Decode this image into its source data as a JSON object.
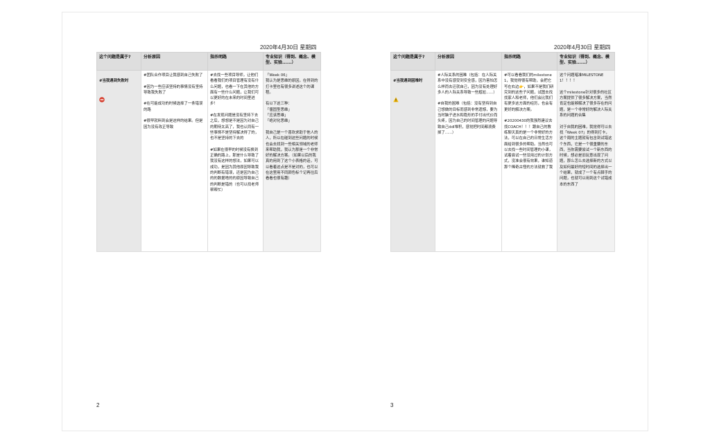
{
  "pages": [
    {
      "date": "2020年4月30日 星期四",
      "page_number": "2",
      "headers": [
        "这个问题是属于?",
        "分析原因",
        "指杀明路",
        "专业知识（得到、概念、模型、实验......）"
      ],
      "question": "#当我遇到失败时",
      "icon": "red-no-entry-icon",
      "cells": [
        "#团队合作项目让我感到自己失败了\n\n#因为一些应该坚持的事情没有坚持导致我失败了\n\n#在可能成功的时候选择了一条错误的路\n\n#很早就料到会是这样的结果。但是因为没有改正导致",
        "#去找一些项目导师，让他们看看我们的项目管理有没有什么问题，也看一下在其他的方面有一些什么问题，让我们可以更好的在未来的时间里进步！\n\n#在发现问题是没有坚持下去之后，想想是不是因为对自己的期待太高了，我也认同有一些事情不是坚持解决得了的，也不是坚持的下去的\n\n#如果在很早的时候没有换到正确的路上，那是什么导致了我没有这样的想法，如果可以成功，是因为其他原因导致我的判断有错误，还是因为自己的的数据啥的的原因导致自己的判断是错的（也可以找老师帮帮忙）",
        "「Week 06」\n我认为是思维的原因，在得到的打卡里也有很多讲述这个的课程。\n\n有以下这三种：\n「僵固型思维」\n「应该思维」\n「绝对化思维」\n\n我自己是一个喜欢求助于他人的人，所以在碰到这些问题的时候也会去找到一些相关领域的老师来帮助我，我认为那是一个非常好的解决方案。（如果以后的我真的用到了这个小表格的话，可以看着这点是不是对的，也可以在这里用不同颜色标个记再往后看看也很有趣）"
      ]
    },
    {
      "date": "2020年4月30日 星期四",
      "page_number": "3",
      "headers": [
        "这个问题是属于?",
        "分析原因",
        "指杀明路",
        "专业知识（得到、概念、模型、实验......）"
      ],
      "question": "#当我遇到困难时",
      "icon": "warning-icon",
      "cells": [
        "#人际关系的困难（包括：在人际关系中没有感受到安全感，因为害怕怎么样而去迁就自己，因为没有处理好多人的人际关系导致一些尴尬......）\n\n#自我的困难（包括：没有坚持到自己想做的目标而感到非常遗憾，要为当时脑子进水和隐形的手付出代价而头疼，因为自己的时间管理的问题导致自己ddl堆积，感觉把时间都浪费掉了......）",
        "#可以看看我们的milestone1，我觉得很有帮助，会把它写在右边👉，如果不是我们研究到的这些子问题，试图去找找家人和老师，他们会比我们有更多这方面的经历，也会有更好的解决方案。\n\n#20200430的我强烈建议去找COACH！！！跟自己的教练聊天真的是一个非常好的方法，可以在自己的日常生活方面给到很多的帮助。当然也可以去找一些时间管理的小课，试着尝试一些没用过的计划方式，没准会很有效果，谁知道那个稀奇古怪的方法就救了我",
        "这个问题暗准MILESTONE1！！！！\n\n这个milestone针对很多的社区方案提供了很多解决方案，当然肯定也能够解决了很多存在的问题，是一个非常好的解决人际关系的问题的合集\n\n对于自我的困难，我觉得可以去找「Week 07」的得到打卡，这个周的主题就有包含到试错这个东西，它是一个很重要的东西，当你需要尝试一个新东西的时候，想必是旧玩意出现了问题，那么怎么去选择新的方式以及如何最好的短时间的选择出一个结果，就成了一个有点棘手的问题，也就可以用到这个试错成本的东西了"
      ]
    }
  ]
}
